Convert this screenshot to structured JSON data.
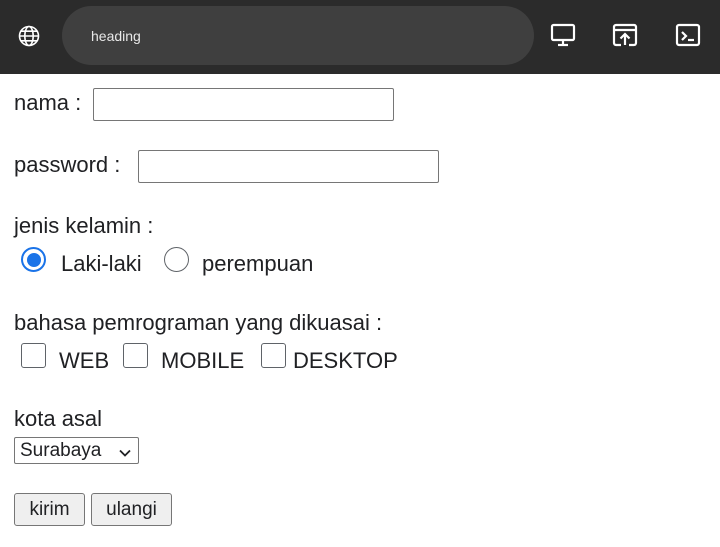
{
  "browser": {
    "address_text": "heading",
    "icons": [
      "globe-icon",
      "desktop-icon",
      "open-in-new-icon",
      "terminal-icon"
    ]
  },
  "form": {
    "nama_label": "nama :",
    "nama_value": "",
    "password_label": "password :",
    "password_value": "",
    "gender_label": "jenis kelamin :",
    "gender_options": [
      "Laki-laki",
      "perempuan"
    ],
    "gender_selected": "Laki-laki",
    "languages_label": "bahasa pemrograman yang dikuasai :",
    "language_options": [
      "WEB",
      "MOBILE",
      "DESKTOP"
    ],
    "city_label": "kota asal",
    "city_selected": "Surabaya",
    "submit_label": "kirim",
    "reset_label": "ulangi"
  },
  "colors": {
    "topbar": "#2b2b2b",
    "address_pill": "#3f3f3f",
    "accent": "#1a73e8"
  }
}
